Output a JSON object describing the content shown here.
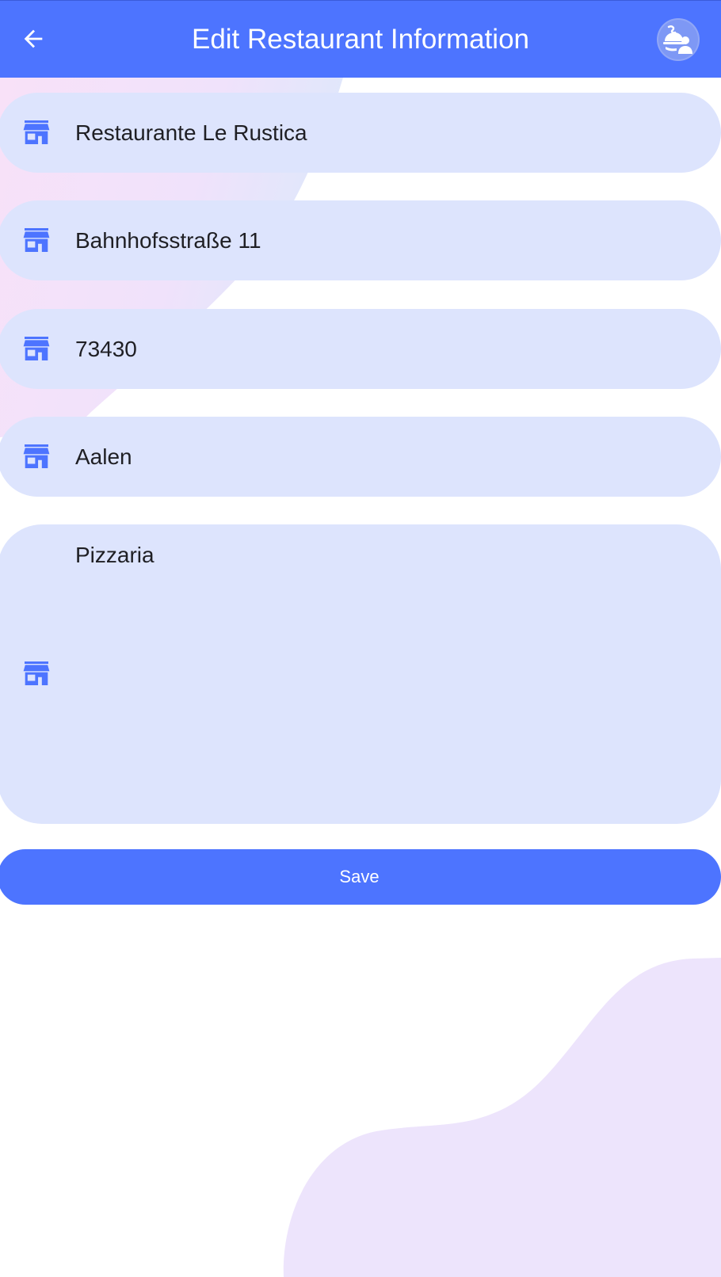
{
  "app_bar": {
    "title": "Edit Restaurant Information",
    "back_icon": "arrow-left-icon",
    "avatar_icon": "restaurant-server-icon"
  },
  "form": {
    "fields": [
      {
        "icon": "store-icon",
        "value": "Restaurante Le Rustica"
      },
      {
        "icon": "store-icon",
        "value": "Bahnhofsstraße 11"
      },
      {
        "icon": "store-icon",
        "value": "73430"
      },
      {
        "icon": "store-icon",
        "value": "Aalen"
      },
      {
        "icon": "store-icon",
        "value": "Pizzaria"
      }
    ],
    "save_label": "Save"
  },
  "colors": {
    "primary": "#4d74ff",
    "field_bg": "#dde4fd",
    "text": "#1f1f24",
    "blob_top_pink": "#f7dff7",
    "blob_top_blue": "#dde8fb",
    "blob_bottom": "#ede4fc"
  }
}
